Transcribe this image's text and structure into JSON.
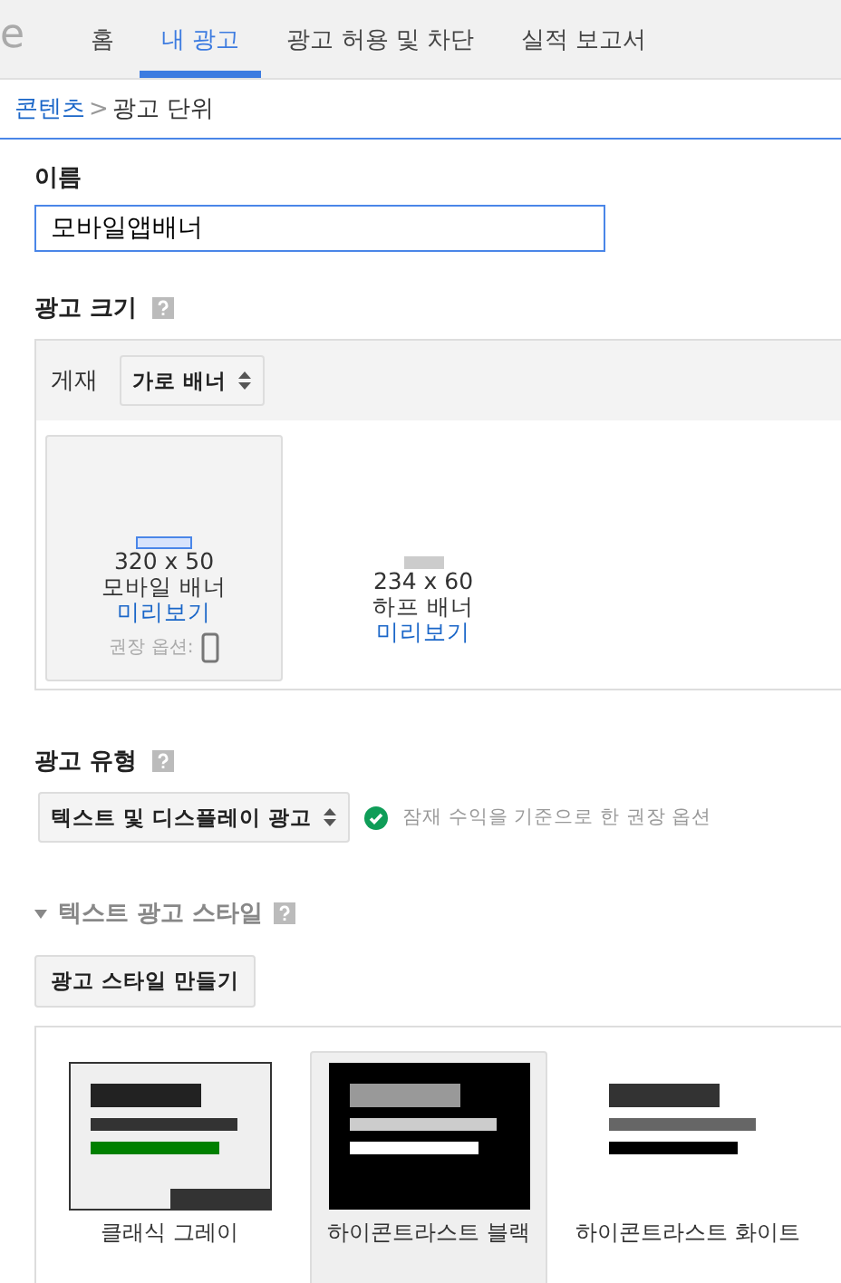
{
  "logo": "e",
  "tabs": [
    {
      "label": "홈",
      "selected": false
    },
    {
      "label": "내 광고",
      "selected": true
    },
    {
      "label": "광고 허용 및 차단",
      "selected": false
    },
    {
      "label": "실적 보고서",
      "selected": false
    }
  ],
  "breadcrumb": {
    "link": "콘텐츠",
    "separator": ">",
    "current": "광고 단위"
  },
  "name_field": {
    "label": "이름",
    "value": "모바일앱배너"
  },
  "ad_size": {
    "title": "광고 크기",
    "placement_label": "게재",
    "placement_value": "가로 배너",
    "sizes": [
      {
        "dims": "320 x 50",
        "name": "모바일 배너",
        "preview": "미리보기",
        "selected": true,
        "recommended": "권장 옵션:"
      },
      {
        "dims": "234 x 60",
        "name": "하프 배너",
        "preview": "미리보기",
        "selected": false
      }
    ]
  },
  "ad_type": {
    "title": "광고 유형",
    "value": "텍스트 및 디스플레이 광고",
    "note": "잠재 수익을 기준으로 한 권장 옵션"
  },
  "text_style": {
    "title": "텍스트 광고 스타일",
    "expanded": true,
    "create_button": "광고 스타일 만들기",
    "styles": [
      {
        "kind": "classic",
        "label": "클래식 그레이",
        "selected": false
      },
      {
        "kind": "black",
        "label": "하이콘트라스트 블랙",
        "selected": true
      },
      {
        "kind": "white",
        "label": "하이콘트라스트 화이트",
        "selected": false
      }
    ]
  }
}
